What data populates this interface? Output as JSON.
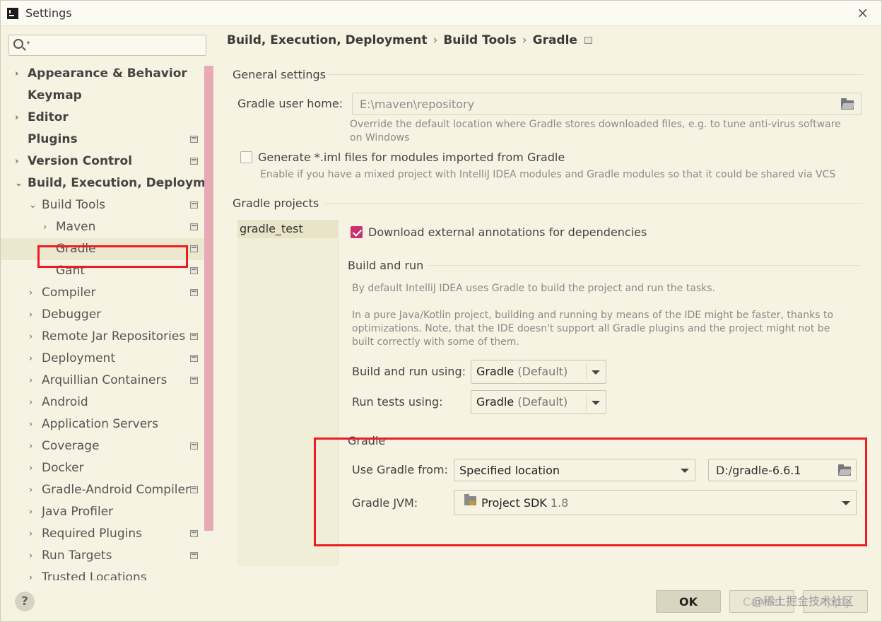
{
  "window": {
    "title": "Settings",
    "close_glyph": "×"
  },
  "search": {
    "placeholder": "",
    "value": ""
  },
  "sidebar": {
    "items": [
      {
        "label": "Appearance & Behavior",
        "bold": true,
        "chevron": "›",
        "level": 0,
        "project_icon": false
      },
      {
        "label": "Keymap",
        "bold": true,
        "chevron": "",
        "level": 0,
        "project_icon": false
      },
      {
        "label": "Editor",
        "bold": true,
        "chevron": "›",
        "level": 0,
        "project_icon": false
      },
      {
        "label": "Plugins",
        "bold": true,
        "chevron": "",
        "level": 0,
        "project_icon": true
      },
      {
        "label": "Version Control",
        "bold": true,
        "chevron": "›",
        "level": 0,
        "project_icon": true
      },
      {
        "label": "Build, Execution, Deployment",
        "bold": true,
        "chevron": "⌄",
        "level": 0,
        "project_icon": false
      },
      {
        "label": "Build Tools",
        "bold": false,
        "chevron": "⌄",
        "level": 1,
        "project_icon": true
      },
      {
        "label": "Maven",
        "bold": false,
        "chevron": "›",
        "level": 2,
        "project_icon": true
      },
      {
        "label": "Gradle",
        "bold": false,
        "chevron": "",
        "level": 2,
        "project_icon": true,
        "selected": true
      },
      {
        "label": "Gant",
        "bold": false,
        "chevron": "",
        "level": 2,
        "project_icon": true
      },
      {
        "label": "Compiler",
        "bold": false,
        "chevron": "›",
        "level": 1,
        "project_icon": true
      },
      {
        "label": "Debugger",
        "bold": false,
        "chevron": "›",
        "level": 1,
        "project_icon": false
      },
      {
        "label": "Remote Jar Repositories",
        "bold": false,
        "chevron": "›",
        "level": 1,
        "project_icon": true
      },
      {
        "label": "Deployment",
        "bold": false,
        "chevron": "›",
        "level": 1,
        "project_icon": true
      },
      {
        "label": "Arquillian Containers",
        "bold": false,
        "chevron": "›",
        "level": 1,
        "project_icon": true
      },
      {
        "label": "Android",
        "bold": false,
        "chevron": "›",
        "level": 1,
        "project_icon": false
      },
      {
        "label": "Application Servers",
        "bold": false,
        "chevron": "›",
        "level": 1,
        "project_icon": false
      },
      {
        "label": "Coverage",
        "bold": false,
        "chevron": "›",
        "level": 1,
        "project_icon": true
      },
      {
        "label": "Docker",
        "bold": false,
        "chevron": "›",
        "level": 1,
        "project_icon": false
      },
      {
        "label": "Gradle-Android Compiler",
        "bold": false,
        "chevron": "›",
        "level": 1,
        "project_icon": true
      },
      {
        "label": "Java Profiler",
        "bold": false,
        "chevron": "›",
        "level": 1,
        "project_icon": false
      },
      {
        "label": "Required Plugins",
        "bold": false,
        "chevron": "›",
        "level": 1,
        "project_icon": true
      },
      {
        "label": "Run Targets",
        "bold": false,
        "chevron": "›",
        "level": 1,
        "project_icon": true
      },
      {
        "label": "Trusted Locations",
        "bold": false,
        "chevron": "›",
        "level": 1,
        "project_icon": false
      }
    ]
  },
  "breadcrumb": {
    "parts": [
      "Build, Execution, Deployment",
      "Build Tools",
      "Gradle"
    ],
    "separator": "›"
  },
  "general": {
    "title": "General settings",
    "user_home_label": "Gradle user home:",
    "user_home_value": "E:\\maven\\repository",
    "user_home_hint": "Override the default location where Gradle stores downloaded files, e.g. to tune anti-virus software on Windows",
    "generate_iml_label": "Generate *.iml files for modules imported from Gradle",
    "generate_iml_checked": false,
    "generate_iml_hint": "Enable if you have a mixed project with IntelliJ IDEA modules and Gradle modules so that it could be shared via VCS"
  },
  "projects": {
    "title": "Gradle projects",
    "list": [
      "gradle_test"
    ],
    "download_annotations_label": "Download external annotations for dependencies",
    "download_annotations_checked": true
  },
  "build_run": {
    "title": "Build and run",
    "hint1": "By default IntelliJ IDEA uses Gradle to build the project and run the tasks.",
    "hint2": "In a pure Java/Kotlin project, building and running by means of the IDE might be faster, thanks to optimizations. Note, that the IDE doesn't support all Gradle plugins and the project might not be built correctly with some of them.",
    "build_using_label": "Build and run using:",
    "build_using_value": "Gradle",
    "build_using_suffix": "(Default)",
    "tests_using_label": "Run tests using:",
    "tests_using_value": "Gradle",
    "tests_using_suffix": "(Default)"
  },
  "gradle": {
    "title": "Gradle",
    "use_from_label": "Use Gradle from:",
    "use_from_value": "Specified location",
    "location_value": "D:/gradle-6.6.1",
    "jvm_label": "Gradle JVM:",
    "jvm_value": "Project SDK",
    "jvm_version": "1.8"
  },
  "buttons": {
    "help": "?",
    "ok": "OK",
    "cancel": "Cancel",
    "apply": "Apply"
  },
  "watermark": "@稀土掘金技术社区",
  "colors": {
    "accent_check": "#c9306e",
    "highlight_red": "#ec1c24",
    "scrollbar": "#e8a9b6"
  }
}
